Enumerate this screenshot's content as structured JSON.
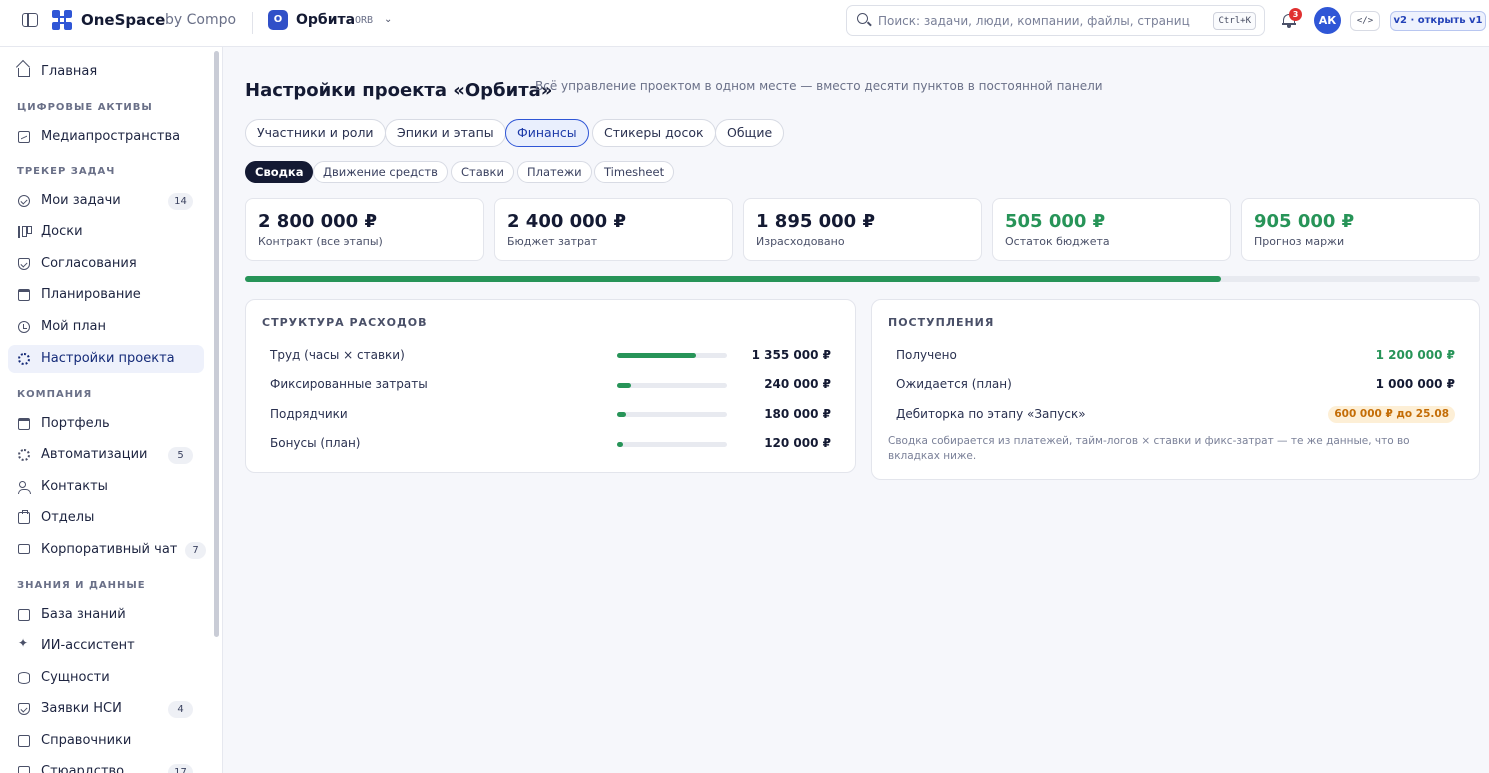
{
  "topbar": {
    "brand": "OneSpace",
    "brand_sub": "by Compo",
    "project": {
      "badge": "O",
      "name": "Орбита",
      "code": "ORB"
    },
    "search": {
      "placeholder": "Поиск: задачи, люди, компании, файлы, страниц",
      "shortcut": "Ctrl+K"
    },
    "notifications_count": "3",
    "avatar_initials": "АК",
    "code_label": "</>",
    "version_label": "v2 · открыть v1"
  },
  "sidebar": {
    "home": "Главная",
    "sections": {
      "digital_assets": "ЦИФРОВЫЕ АКТИВЫ",
      "task_tracker": "ТРЕКЕР ЗАДАЧ",
      "company": "КОМПАНИЯ",
      "knowledge": "ЗНАНИЯ И ДАННЫЕ"
    },
    "items": {
      "media": "Медиапространства",
      "my_tasks": {
        "label": "Мои задачи",
        "count": "14"
      },
      "boards": "Доски",
      "approvals": "Согласования",
      "planning": "Планирование",
      "my_plan": "Мой план",
      "project_settings": "Настройки проекта",
      "portfolio": "Портфель",
      "automations": {
        "label": "Автоматизации",
        "count": "5"
      },
      "contacts": "Контакты",
      "departments": "Отделы",
      "corp_chat": {
        "label": "Корпоративный чат",
        "count": "7"
      },
      "knowledge_base": "База знаний",
      "ai_assistant": "ИИ-ассистент",
      "entities": "Сущности",
      "nsi_requests": {
        "label": "Заявки НСИ",
        "count": "4"
      },
      "directories": "Справочники",
      "stewardship": {
        "label": "Стюардство",
        "count": "17"
      }
    }
  },
  "main": {
    "title": "Настройки проекта «Орбита»",
    "subtitle": "Всё управление проектом в одном месте — вместо десяти пунктов в постоянной панели",
    "tabs": [
      "Участники и роли",
      "Эпики и этапы",
      "Финансы",
      "Стикеры досок",
      "Общие"
    ],
    "active_tab": "Финансы",
    "subtabs": [
      "Сводка",
      "Движение средств",
      "Ставки",
      "Платежи",
      "Timesheet"
    ],
    "active_subtab": "Сводка",
    "kpis": [
      {
        "value": "2 800 000 ₽",
        "label": "Контракт (все этапы)"
      },
      {
        "value": "2 400 000 ₽",
        "label": "Бюджет затрат"
      },
      {
        "value": "1 895 000 ₽",
        "label": "Израсходовано"
      },
      {
        "value": "505 000 ₽",
        "label": "Остаток бюджета"
      },
      {
        "value": "905 000 ₽",
        "label": "Прогноз маржи"
      }
    ],
    "budget_spent_fraction": 0.79,
    "expenses": {
      "title": "СТРУКТУРА РАСХОДОВ",
      "rows": [
        {
          "label": "Труд (часы × ставки)",
          "value": "1 355 000 ₽",
          "share": 0.72
        },
        {
          "label": "Фиксированные затраты",
          "value": "240 000 ₽",
          "share": 0.13
        },
        {
          "label": "Подрядчики",
          "value": "180 000 ₽",
          "share": 0.08
        },
        {
          "label": "Бонусы (план)",
          "value": "120 000 ₽",
          "share": 0.05
        }
      ]
    },
    "income": {
      "title": "ПОСТУПЛЕНИЯ",
      "received_label": "Получено",
      "received_value": "1 200 000 ₽",
      "expected_label": "Ожидается (план)",
      "expected_value": "1 000 000 ₽",
      "receivable_label": "Дебиторка по этапу «Запуск»",
      "receivable_value": "600 000 ₽ до 25.08",
      "note": "Сводка собирается из платежей, тайм-логов × ставки и фикс-затрат — те же данные, что во вкладках ниже."
    }
  },
  "colors": {
    "accent": "#2f56d6",
    "positive": "#279458",
    "warning": "#c46d06"
  }
}
